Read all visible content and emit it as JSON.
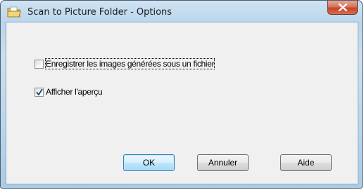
{
  "window": {
    "title": "Scan to Picture Folder - Options",
    "icon": "folder-scanner-icon",
    "close_icon": "close-icon"
  },
  "options": {
    "save_to_file": {
      "label": "Enregistrer les images générées sous un fichier",
      "checked": false
    },
    "show_preview": {
      "label": "Afficher l'aperçu",
      "checked": true
    }
  },
  "buttons": {
    "ok": "OK",
    "cancel": "Annuler",
    "help": "Aide"
  },
  "colors": {
    "close_button": "#c7432a",
    "frame": "#b9d5ec",
    "client_bg": "#f0f0f0",
    "default_button_border": "#3c7fb1"
  }
}
